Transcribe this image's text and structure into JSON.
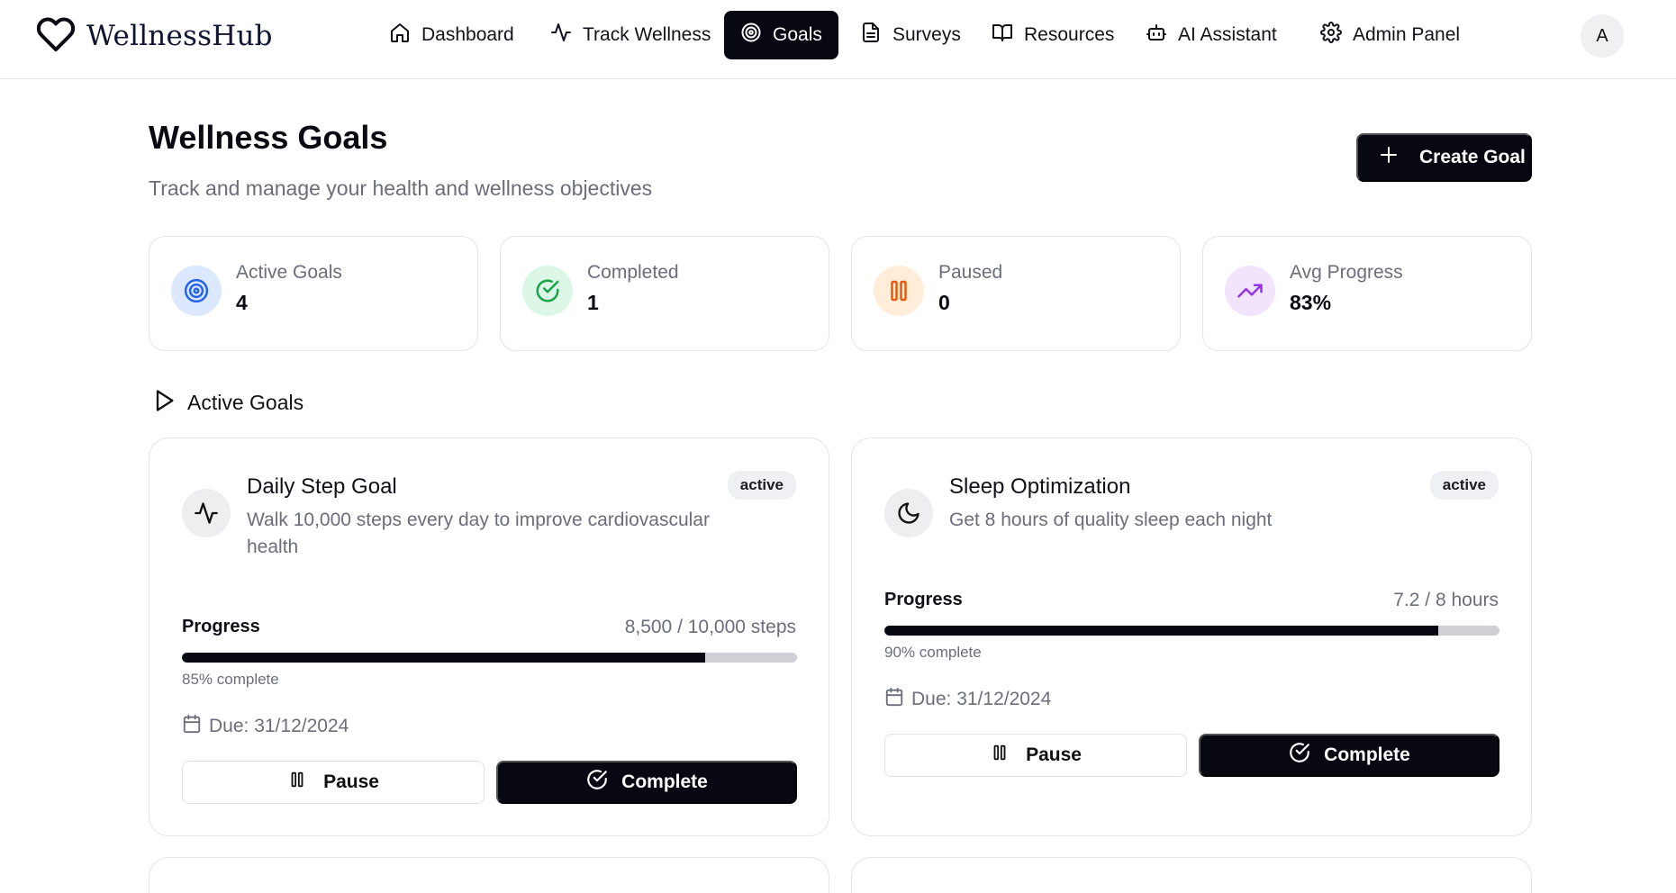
{
  "app": {
    "name": "WellnessHub",
    "logo_icon": "heart-icon"
  },
  "nav": {
    "items": [
      {
        "label": "Dashboard",
        "icon": "home-icon",
        "active": false
      },
      {
        "label": "Track Wellness",
        "icon": "activity-icon",
        "active": false
      },
      {
        "label": "Goals",
        "icon": "target-icon",
        "active": true
      },
      {
        "label": "Surveys",
        "icon": "document-icon",
        "active": false
      },
      {
        "label": "Resources",
        "icon": "book-icon",
        "active": false
      },
      {
        "label": "AI Assistant",
        "icon": "bot-icon",
        "active": false
      },
      {
        "label": "Admin Panel",
        "icon": "gear-icon",
        "active": false
      }
    ],
    "avatar_initial": "A"
  },
  "header": {
    "title": "Wellness Goals",
    "subtitle": "Track and manage your health and wellness objectives",
    "create_button": "Create Goal"
  },
  "stats": [
    {
      "label": "Active Goals",
      "value": "4",
      "icon": "target-icon",
      "color": "#2563eb",
      "bg": "#dbe8fd"
    },
    {
      "label": "Completed",
      "value": "1",
      "icon": "check-circle-icon",
      "color": "#16a34a",
      "bg": "#dcf7e6"
    },
    {
      "label": "Paused",
      "value": "0",
      "icon": "pause-icon",
      "color": "#ea580c",
      "bg": "#ffedd9"
    },
    {
      "label": "Avg Progress",
      "value": "83%",
      "icon": "trending-up-icon",
      "color": "#9333ea",
      "bg": "#f3e4fd"
    }
  ],
  "section": {
    "title": "Active Goals",
    "icon": "play-icon"
  },
  "goals": [
    {
      "title": "Daily Step Goal",
      "description": "Walk 10,000 steps every day to improve cardiovascular health",
      "status": "active",
      "icon": "activity-icon",
      "progress_label": "Progress",
      "progress_amount": "8,500 / 10,000 steps",
      "progress_fraction": 0.85,
      "percent_text": "85% complete",
      "due": "Due: 31/12/2024",
      "pause_label": "Pause",
      "complete_label": "Complete"
    },
    {
      "title": "Sleep Optimization",
      "description": "Get 8 hours of quality sleep each night",
      "status": "active",
      "icon": "moon-icon",
      "progress_label": "Progress",
      "progress_amount": "7.2 / 8 hours",
      "progress_fraction": 0.9,
      "percent_text": "90% complete",
      "due": "Due: 31/12/2024",
      "pause_label": "Pause",
      "complete_label": "Complete"
    }
  ]
}
